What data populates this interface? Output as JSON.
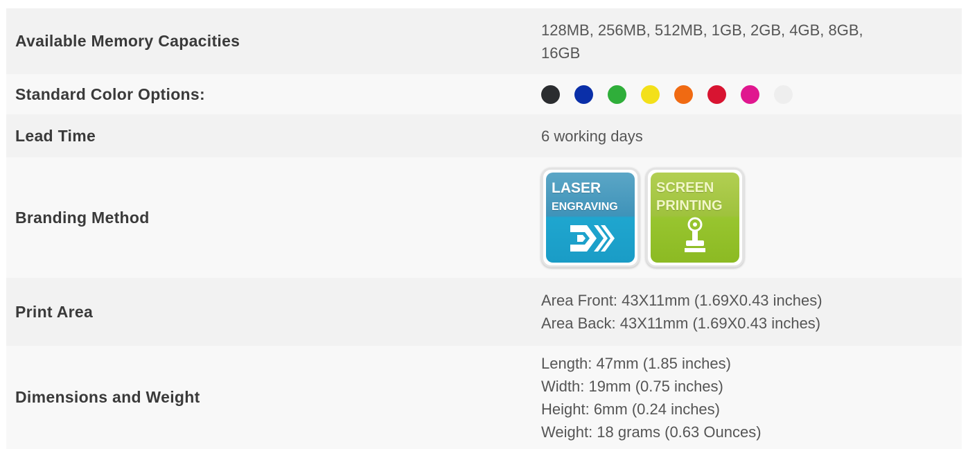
{
  "rows": [
    {
      "label": "Available Memory Capacities",
      "value_line1": "128MB, 256MB, 512MB, 1GB, 2GB, 4GB, 8GB,",
      "value_line2": "16GB"
    },
    {
      "label": "Standard Color Options:",
      "colors": [
        "#2b2d30",
        "#0a2fa8",
        "#2fae3a",
        "#f3e01a",
        "#f06a12",
        "#d81431",
        "#e0178f",
        "#eeeeee"
      ]
    },
    {
      "label": "Lead Time",
      "value": "6 working days"
    },
    {
      "label": "Branding Method",
      "badges": [
        {
          "line1": "LASER",
          "line2": "ENGRAVING",
          "icon": "laser-arrow-icon"
        },
        {
          "line1": "SCREEN",
          "line2": "PRINTING",
          "icon": "stamp-icon"
        }
      ]
    },
    {
      "label": "Print Area",
      "lines": [
        "Area Front: 43X11mm (1.69X0.43 inches)",
        "Area Back: 43X11mm (1.69X0.43 inches)"
      ]
    },
    {
      "label": "Dimensions and Weight",
      "lines": [
        "Length: 47mm (1.85 inches)",
        "Width: 19mm (0.75 inches)",
        "Height: 6mm (0.24 inches)",
        "Weight: 18 grams (0.63 Ounces)"
      ]
    }
  ]
}
